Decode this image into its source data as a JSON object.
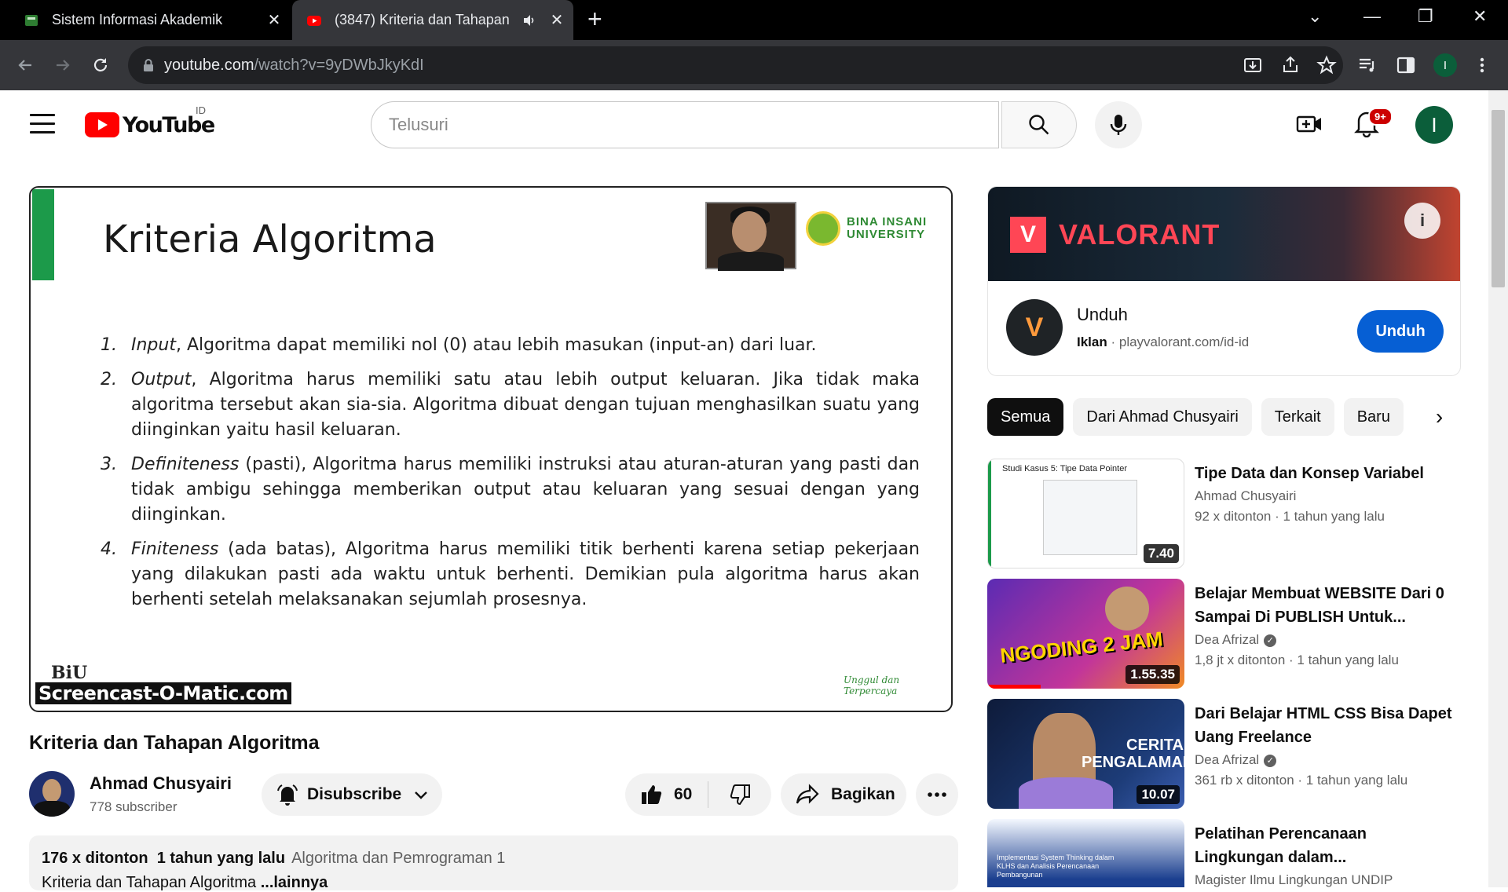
{
  "browser": {
    "tabs": [
      {
        "title": "Sistem Informasi Akademik",
        "active": false
      },
      {
        "title": "(3847) Kriteria dan Tahapan",
        "active": true
      }
    ],
    "url_host": "youtube.com",
    "url_path": "/watch?v=9yDWbJkyKdI",
    "profile_initial": "I"
  },
  "youtube": {
    "logo_text": "YouTube",
    "country_code": "ID",
    "search_placeholder": "Telusuri",
    "notification_count": "9+",
    "avatar_initial": "I"
  },
  "video": {
    "slide": {
      "title": "Kriteria Algoritma",
      "university": [
        "BINA INSANI",
        "UNIVERSITY"
      ],
      "items": [
        {
          "num": "1.",
          "term": "Input",
          "text": ", Algoritma dapat memiliki nol (0) atau lebih masukan (input-an) dari luar."
        },
        {
          "num": "2.",
          "term": "Output",
          "text": ", Algoritma harus memiliki satu atau lebih output keluaran. Jika tidak maka algoritma tersebut akan sia-sia. Algoritma dibuat dengan tujuan menghasilkan suatu yang diinginkan yaitu hasil keluaran."
        },
        {
          "num": "3.",
          "term": "Definiteness",
          "text": " (pasti), Algoritma harus memiliki instruksi atau aturan-aturan yang pasti dan tidak ambigu sehingga memberikan output atau keluaran yang sesuai dengan yang diinginkan."
        },
        {
          "num": "4.",
          "term": "Finiteness",
          "text": " (ada batas), Algoritma harus memiliki titik berhenti karena setiap pekerjaan yang dilakukan pasti ada waktu untuk berhenti. Demikian pula algoritma harus akan berhenti setelah melaksanakan sejumlah prosesnya."
        }
      ],
      "watermark": "Screencast-O-Matic.com",
      "logo_small": "BiU",
      "tagline": "Unggul dan Terpercaya"
    },
    "title": "Kriteria dan Tahapan Algoritma",
    "channel": {
      "name": "Ahmad Chusyairi",
      "subscribers": "778 subscriber"
    },
    "subscribe_label": "Disubscribe",
    "likes": "60",
    "share_label": "Bagikan",
    "description": {
      "views": "176 x ditonton",
      "age": "1 tahun yang lalu",
      "tag": "Algoritma dan Pemrograman 1",
      "line2": "Kriteria dan Tahapan Algoritma",
      "more": "...lainnya"
    }
  },
  "ad": {
    "brand": "VALORANT",
    "title": "Unduh",
    "label": "Iklan",
    "domain": "playvalorant.com/id-id",
    "button": "Unduh"
  },
  "chips": [
    "Semua",
    "Dari Ahmad Chusyairi",
    "Terkait",
    "Baru"
  ],
  "recommendations": [
    {
      "title": "Tipe Data dan Konsep Variabel",
      "channel": "Ahmad Chusyairi",
      "verified": false,
      "views": "92 x ditonton",
      "age": "1 tahun yang lalu",
      "duration": "7.40",
      "thumb_text": "Studi Kasus 5: Tipe Data Pointer"
    },
    {
      "title": "Belajar Membuat WEBSITE Dari 0 Sampai Di PUBLISH Untuk...",
      "channel": "Dea Afrizal",
      "verified": true,
      "views": "1,8 jt x ditonton",
      "age": "1 tahun yang lalu",
      "duration": "1.55.35",
      "thumb_text": "NGODING 2 JAM"
    },
    {
      "title": "Dari Belajar HTML CSS Bisa Dapet Uang Freelance",
      "channel": "Dea Afrizal",
      "verified": true,
      "views": "361 rb x ditonton",
      "age": "1 tahun yang lalu",
      "duration": "10.07",
      "thumb_text": "CERITA PENGALAMAN"
    },
    {
      "title": "Pelatihan Perencanaan Lingkungan dalam...",
      "channel": "Magister Ilmu Lingkungan UNDIP",
      "verified": false,
      "views": "",
      "age": "",
      "duration": "",
      "thumb_text": "Implementasi System Thinking dalam KLHS dan Analisis Perencanaan Pembangunan"
    }
  ],
  "colors": {
    "youtube_red": "#ff0000",
    "accent_blue": "#065fd4",
    "slide_green": "#1c9a4a"
  }
}
